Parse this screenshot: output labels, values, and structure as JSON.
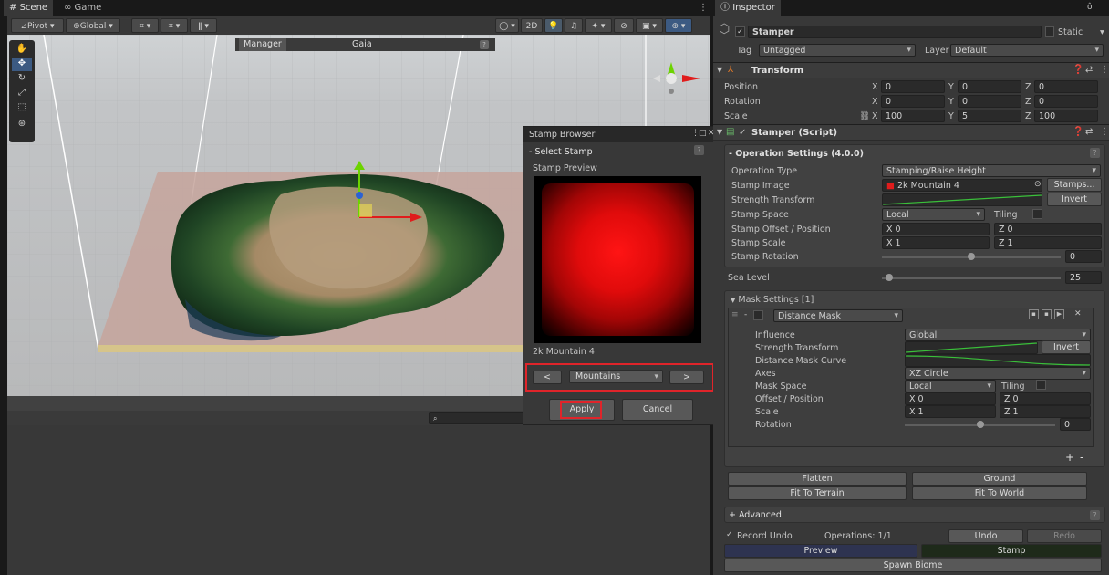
{
  "scene_tabs": {
    "scene": "Scene",
    "game": "Game"
  },
  "scene_toolbar": {
    "pivot": "Pivot",
    "global": "Global",
    "mode_2d": "2D"
  },
  "overlay": {
    "manager": "Manager",
    "gaia": "Gaia"
  },
  "stamp_browser": {
    "title": "Stamp Browser",
    "section": "- Select Stamp",
    "preview_label": "Stamp Preview",
    "stamp_name": "2k Mountain 4",
    "prev": "<",
    "category": "Mountains",
    "next": ">",
    "apply": "Apply",
    "cancel": "Cancel",
    "help": "?"
  },
  "scene_search": {
    "icon": "search-icon"
  },
  "inspector": {
    "tab": "Inspector",
    "object_name": "Stamper",
    "static_label": "Static",
    "tag_label": "Tag",
    "tag_value": "Untagged",
    "layer_label": "Layer",
    "layer_value": "Default",
    "transform": {
      "title": "Transform",
      "rows": [
        {
          "label": "Position",
          "x": "0",
          "y": "0",
          "z": "0"
        },
        {
          "label": "Rotation",
          "x": "0",
          "y": "0",
          "z": "0"
        },
        {
          "label": "Scale",
          "x": "100",
          "y": "5",
          "z": "100"
        }
      ],
      "axis_x": "X",
      "axis_y": "Y",
      "axis_z": "Z"
    },
    "stamper": {
      "title": "Stamper (Script)",
      "operation_settings": "- Operation Settings  (4.0.0)",
      "operation_type_label": "Operation Type",
      "operation_type_value": "Stamping/Raise Height",
      "stamp_image_label": "Stamp Image",
      "stamp_image_value": "2k Mountain 4",
      "stamps_button": "Stamps...",
      "strength_transform_label": "Strength Transform",
      "invert": "Invert",
      "stamp_space_label": "Stamp Space",
      "stamp_space_value": "Local",
      "tiling_label": "Tiling",
      "offset_label": "Stamp Offset / Position",
      "offset_x": "X 0",
      "offset_z": "Z 0",
      "scale_label": "Stamp Scale",
      "scale_x": "X 1",
      "scale_z": "Z 1",
      "rotation_label": "Stamp Rotation",
      "rotation_value": "0",
      "sea_level_label": "Sea Level",
      "sea_level_value": "25",
      "sea_level_fraction": 0.04,
      "rotation_fraction": 0.5
    },
    "mask": {
      "title": "Mask Settings [1]",
      "mask_name": "Distance Mask",
      "influence_label": "Influence",
      "influence_value": "Global",
      "strength_label": "Strength Transform",
      "invert": "Invert",
      "curve_label": "Distance Mask Curve",
      "axes_label": "Axes",
      "axes_value": "XZ Circle",
      "space_label": "Mask Space",
      "space_value": "Local",
      "tiling_label": "Tiling",
      "offset_label": "Offset / Position",
      "offset_x": "X 0",
      "offset_z": "Z 0",
      "scale_label": "Scale",
      "scale_x": "X 1",
      "scale_z": "Z 1",
      "rotation_label": "Rotation",
      "rotation_value": "0",
      "rotation_fraction": 0.5,
      "plus": "+",
      "minus": "-"
    },
    "buttons": {
      "flatten": "Flatten",
      "ground": "Ground",
      "fit_terrain": "Fit To Terrain",
      "fit_world": "Fit To World"
    },
    "advanced": "+ Advanced",
    "record_undo": "Record Undo",
    "operations": "Operations: 1/1",
    "undo": "Undo",
    "redo": "Redo",
    "preview": "Preview",
    "stamp": "Stamp",
    "spawn_biome": "Spawn Biome"
  },
  "colors": {
    "highlight": "#e0242a",
    "preview_blue": "#2e3350",
    "stamp_green": "#1e2a1a"
  }
}
